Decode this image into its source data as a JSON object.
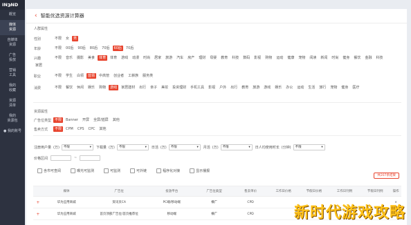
{
  "app": {
    "logo": "IN℈ND",
    "page_title": "智能优选资源计算器"
  },
  "sidebar": {
    "items": [
      {
        "label": "概览"
      },
      {
        "label": "媒体\n资源"
      },
      {
        "label": "自媒体\n资源"
      },
      {
        "label": "广告\n投放"
      },
      {
        "label": "营销\n工具"
      },
      {
        "label": "我的\n收藏"
      },
      {
        "label": "资源\n清单"
      },
      {
        "label": "我的\n资源包"
      },
      {
        "label": "● 我的账号"
      }
    ]
  },
  "audience": {
    "section": "人群属性",
    "rows": [
      {
        "label": "性别",
        "options": [
          "不限",
          "女",
          "男"
        ],
        "selected": 2
      },
      {
        "label": "年龄",
        "options": [
          "不限",
          "00后",
          "90后",
          "80后",
          "70后",
          "60后",
          "70后"
        ],
        "selected": 5
      },
      {
        "label": "兴趣",
        "options": [
          "不限",
          "音乐",
          "摄影",
          "美食",
          "体育",
          "体育",
          "游戏",
          "动漫",
          "时尚",
          "居家",
          "旅游",
          "汽车",
          "房产",
          "理财",
          "母婴",
          "教育",
          "科技",
          "数码",
          "影视",
          "购物",
          "运动",
          "健康",
          "宠物",
          "阅读",
          "新闻",
          "时尚",
          "健身",
          "餐饮",
          "金融",
          "科技",
          "家居"
        ],
        "selected": 4
      },
      {
        "label": "职业",
        "options": [
          "不限",
          "学生",
          "白领",
          "蓝领",
          "中高管",
          "创业者",
          "工薪族",
          "服务类"
        ],
        "selected": 3
      },
      {
        "label": "消费",
        "options": [
          "不限",
          "餐饮",
          "休闲",
          "娱乐",
          "购物",
          "游戏",
          "家居建材",
          "出行",
          "亲子",
          "美妆",
          "投资理财",
          "手机工具",
          "影视",
          "户外",
          "出行",
          "教育",
          "旅游",
          "游戏",
          "娱乐",
          "办公",
          "运动",
          "生活",
          "旅行",
          "宠物",
          "健身",
          "医疗"
        ],
        "selected": 5
      }
    ]
  },
  "resource": {
    "section": "资源属性",
    "rows": [
      {
        "label": "广告位类型",
        "options": [
          "不限",
          "Banner",
          "开屏",
          "全屏/插屏",
          "其他"
        ],
        "selected": 0
      },
      {
        "label": "售卖方式",
        "options": [
          "不限",
          "CPM",
          "CPS",
          "CPC",
          "其他"
        ],
        "selected": 0
      }
    ]
  },
  "filters": {
    "row1": [
      {
        "label": "注册用户量",
        "unit": "(万)",
        "value": "不限"
      },
      {
        "label": "下载量",
        "unit": "(万)",
        "value": "不限"
      },
      {
        "label": "日活",
        "unit": "(万)",
        "value": "不限"
      },
      {
        "label": "月活",
        "unit": "(万)",
        "value": "不限"
      },
      {
        "label": "日人均使用时长",
        "unit": "(分钟)",
        "value": "不限"
      }
    ],
    "price_label": "价格区间",
    "price_from": "",
    "price_to": ""
  },
  "checkboxes": [
    "含市可查阅",
    "曝光可监测",
    "可监测",
    "可外链",
    "程序化对接",
    "显示播报"
  ],
  "add_button": "共207条结果",
  "table": {
    "headers": [
      "",
      "媒体",
      "广告位",
      "投放平台",
      "广告位类型",
      "售卖单价",
      "工作日价格",
      "节假日价格",
      "工作日刊例",
      "节假日刊例",
      "操作"
    ],
    "rows": [
      [
        "+",
        "华为应用商城",
        "资讯页CA",
        "PC端/移动端",
        "横广",
        "CPD",
        "",
        "",
        "",
        "",
        "×"
      ],
      [
        "+",
        "华为应用商城",
        "首页顶部广告位/首页推荐位",
        "移动端",
        "横广",
        "CPD",
        "",
        "",
        "",
        "",
        ""
      ]
    ]
  },
  "watermark": "新时代游戏攻略",
  "colors": {
    "accent": "#e8442e",
    "sidebar": "#2d3240"
  }
}
